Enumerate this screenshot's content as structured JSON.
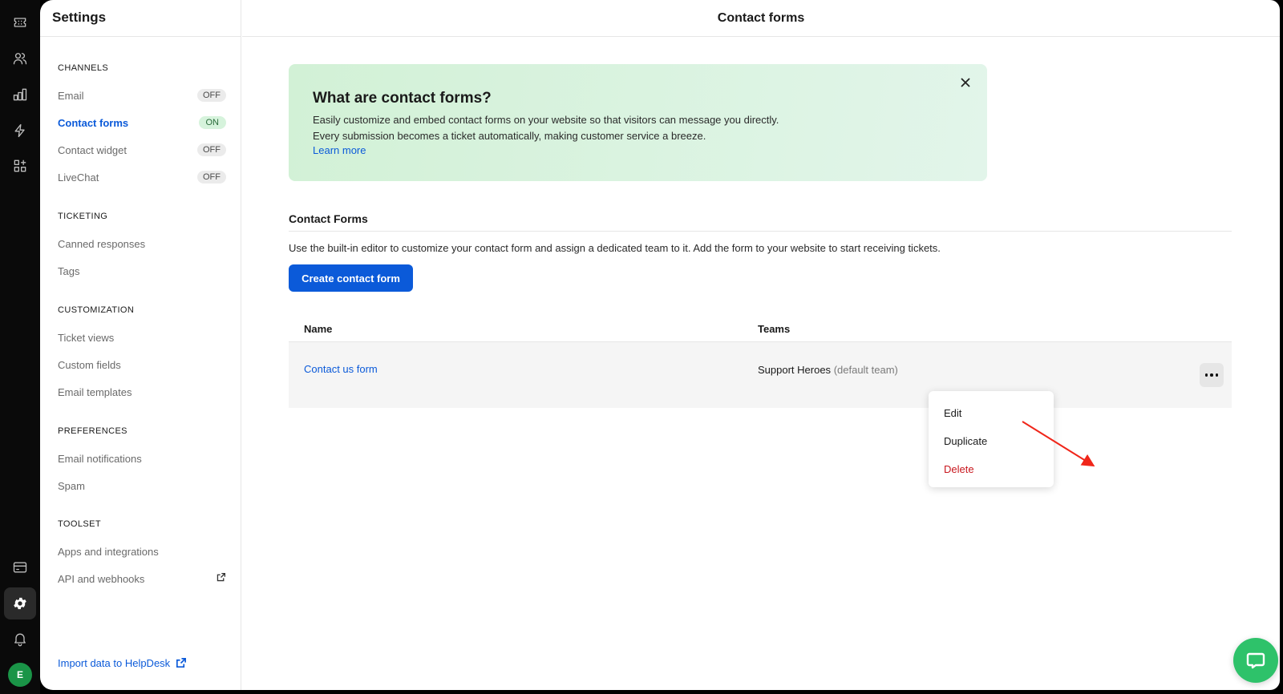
{
  "rail": {
    "icons": [
      "tickets-icon",
      "contacts-icon",
      "reports-icon",
      "automation-icon",
      "apps-icon",
      "billing-icon",
      "settings-icon",
      "notifications-icon"
    ],
    "avatar_initial": "E"
  },
  "sidebar": {
    "title": "Settings",
    "sections": [
      {
        "label": "CHANNELS",
        "items": [
          {
            "label": "Email",
            "badge": "OFF"
          },
          {
            "label": "Contact forms",
            "badge": "ON",
            "active": true
          },
          {
            "label": "Contact widget",
            "badge": "OFF"
          },
          {
            "label": "LiveChat",
            "badge": "OFF"
          }
        ]
      },
      {
        "label": "TICKETING",
        "items": [
          {
            "label": "Canned responses"
          },
          {
            "label": "Tags"
          }
        ]
      },
      {
        "label": "CUSTOMIZATION",
        "items": [
          {
            "label": "Ticket views"
          },
          {
            "label": "Custom fields"
          },
          {
            "label": "Email templates"
          }
        ]
      },
      {
        "label": "PREFERENCES",
        "items": [
          {
            "label": "Email notifications"
          },
          {
            "label": "Spam"
          }
        ]
      },
      {
        "label": "TOOLSET",
        "items": [
          {
            "label": "Apps and integrations"
          },
          {
            "label": "API and webhooks",
            "external": true
          }
        ]
      }
    ],
    "import_link": "Import data to HelpDesk"
  },
  "main": {
    "header_title": "Contact forms",
    "banner": {
      "title": "What are contact forms?",
      "text": "Easily customize and embed contact forms on your website so that visitors can message you directly. Every submission becomes a ticket automatically, making customer service a breeze.",
      "link": "Learn more"
    },
    "section": {
      "title": "Contact Forms",
      "description": "Use the built-in editor to customize your contact form and assign a dedicated team to it. Add the form to your website to start receiving tickets.",
      "create_button": "Create contact form"
    },
    "table": {
      "columns": [
        "Name",
        "Teams"
      ],
      "rows": [
        {
          "name": "Contact us form",
          "team": "Support Heroes",
          "team_note": "(default team)"
        }
      ]
    },
    "row_menu": {
      "items": [
        "Edit",
        "Duplicate",
        "Delete"
      ]
    }
  },
  "colors": {
    "accent": "#0b5ad9",
    "on_badge": "#d6f3dc",
    "danger": "#c8171e",
    "chat": "#2ec26a",
    "annotation": "#f0261a"
  }
}
